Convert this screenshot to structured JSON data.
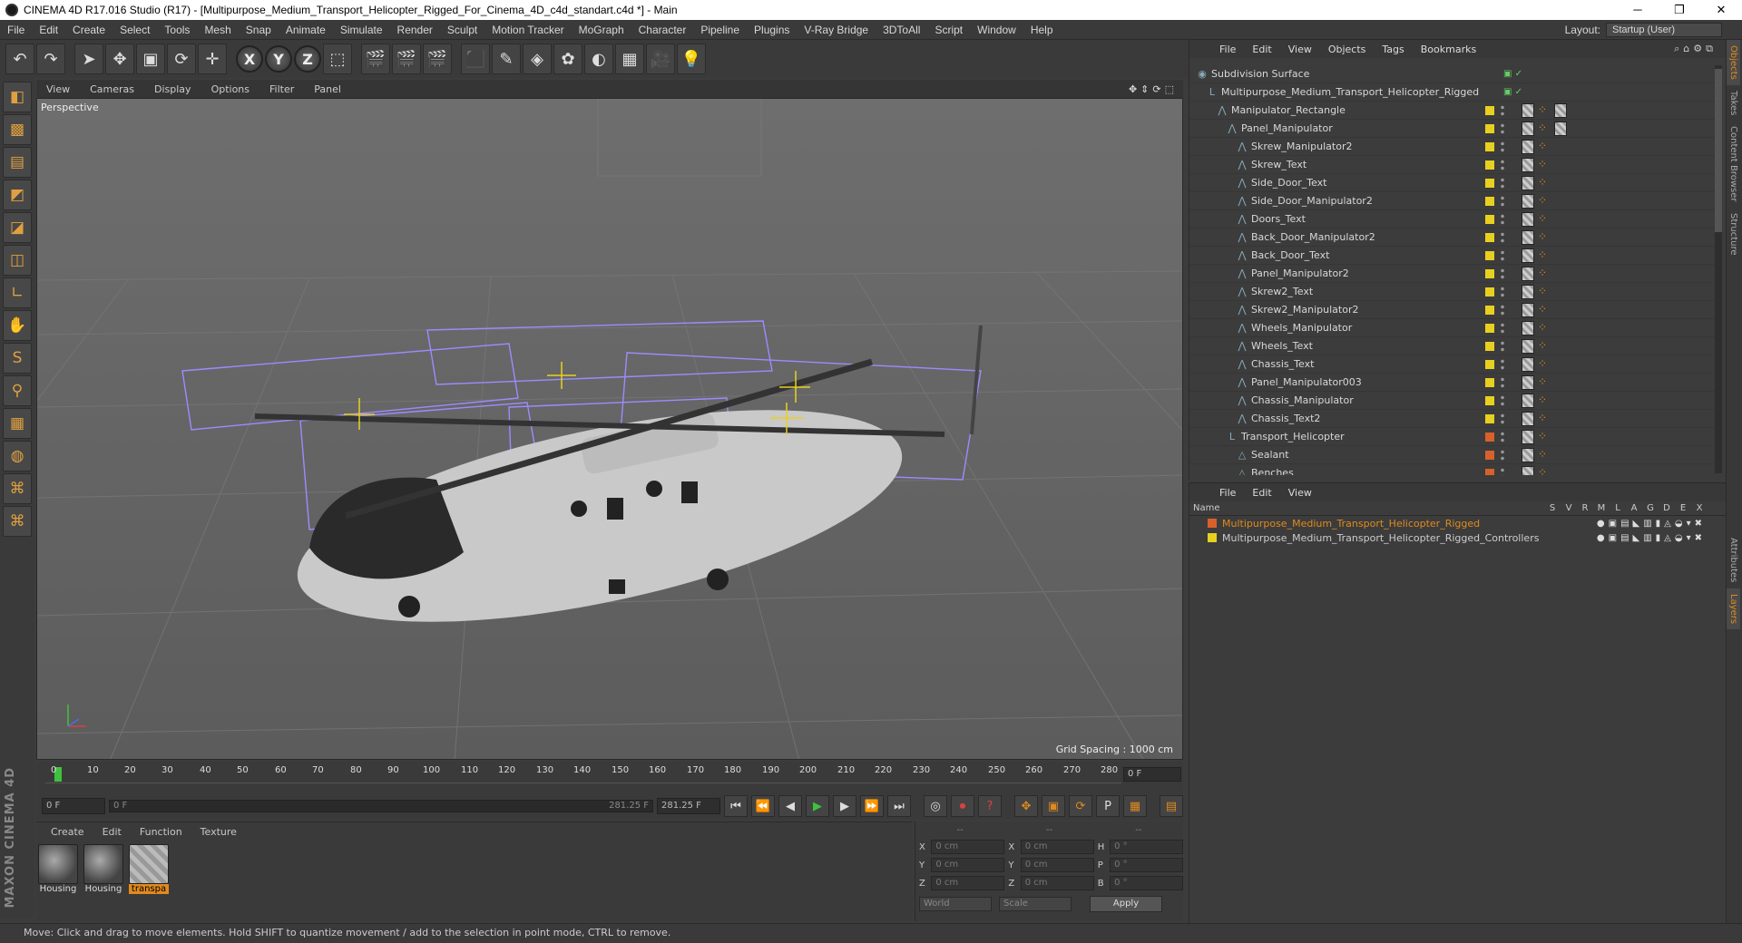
{
  "window": {
    "title": "CINEMA 4D R17.016 Studio (R17) - [Multipurpose_Medium_Transport_Helicopter_Rigged_For_Cinema_4D_c4d_standart.c4d *] - Main",
    "min": "─",
    "max": "❐",
    "close": "✕"
  },
  "menu": [
    "File",
    "Edit",
    "Create",
    "Select",
    "Tools",
    "Mesh",
    "Snap",
    "Animate",
    "Simulate",
    "Render",
    "Sculpt",
    "Motion Tracker",
    "MoGraph",
    "Character",
    "Pipeline",
    "Plugins",
    "V-Ray Bridge",
    "3DToAll",
    "Script",
    "Window",
    "Help"
  ],
  "layout": {
    "label": "Layout:",
    "value": "Startup (User)"
  },
  "toolbar": {
    "undo": "↶",
    "redo": "↷",
    "select": "➤",
    "move": "✥",
    "scale": "▣",
    "rotate": "⟳",
    "move2": "✛",
    "x": "X",
    "y": "Y",
    "z": "Z",
    "coord": "⬚",
    "render_view": "🎬",
    "render": "🎬",
    "render_settings": "🎬",
    "cube": "⬛",
    "pen": "✎",
    "subdiv": "◈",
    "cloner": "✿",
    "deformer": "◐",
    "floor": "▦",
    "camera": "🎥",
    "light": "💡"
  },
  "left_tools": [
    "◧",
    "▩",
    "▤",
    "◩",
    "◪",
    "◫",
    "∟",
    "✋",
    "S",
    "⚲",
    "▦",
    "◍",
    "⌘",
    "⌘"
  ],
  "maxon_logo": "MAXON CINEMA 4D",
  "viewport": {
    "menu": [
      "View",
      "Cameras",
      "Display",
      "Options",
      "Filter",
      "Panel"
    ],
    "nav_icons": "✥⇕⟳⬚",
    "camera": "Perspective",
    "grid_spacing": "Grid Spacing : 1000 cm"
  },
  "timeline": {
    "ticks": [
      "0",
      "10",
      "20",
      "30",
      "40",
      "50",
      "60",
      "70",
      "80",
      "90",
      "100",
      "110",
      "120",
      "130",
      "140",
      "150",
      "160",
      "170",
      "180",
      "190",
      "200",
      "210",
      "220",
      "230",
      "240",
      "250",
      "260",
      "270",
      "280"
    ],
    "current_frame": "0 F",
    "start": "0 F",
    "slider_start": "0 F",
    "slider_end": "281.25 F",
    "end": "281.25 F"
  },
  "transport_buttons": [
    "⏮",
    "⏪",
    "◀",
    "▶",
    "▶",
    "⏩",
    "⏭"
  ],
  "transport_extra": [
    "◎",
    "⏺",
    "?",
    "✥",
    "▣",
    "⟳",
    "P",
    "▦",
    "▤"
  ],
  "materials": {
    "menu": [
      "Create",
      "Edit",
      "Function",
      "Texture"
    ],
    "items": [
      {
        "name": "Housing",
        "style": "ball"
      },
      {
        "name": "Housing",
        "style": "ball"
      },
      {
        "name": "transpa",
        "style": "stripe"
      }
    ]
  },
  "coords": {
    "headers": [
      "--",
      "--",
      "--"
    ],
    "rows": [
      {
        "a1": "X",
        "v1": "0 cm",
        "a2": "X",
        "v2": "0 cm",
        "a3": "H",
        "v3": "0 °"
      },
      {
        "a1": "Y",
        "v1": "0 cm",
        "a2": "Y",
        "v2": "0 cm",
        "a3": "P",
        "v3": "0 °"
      },
      {
        "a1": "Z",
        "v1": "0 cm",
        "a2": "Z",
        "v2": "0 cm",
        "a3": "B",
        "v3": "0 °"
      }
    ],
    "space": "World",
    "mode": "Scale",
    "apply": "Apply"
  },
  "status": "Move: Click and drag to move elements. Hold SHIFT to quantize movement / add to the selection in point mode, CTRL to remove.",
  "object_manager": {
    "menu": [
      "File",
      "Edit",
      "View",
      "Objects",
      "Tags",
      "Bookmarks"
    ],
    "icons": "⌕⌂⚙⧉",
    "objects": [
      {
        "name": "Subdivision Surface",
        "indent": 0,
        "color": "",
        "kind": "subdiv"
      },
      {
        "name": "Multipurpose_Medium_Transport_Helicopter_Rigged",
        "indent": 1,
        "color": "",
        "kind": "null"
      },
      {
        "name": "Manipulator_Rectangle",
        "indent": 2,
        "color": "#e8d020",
        "kind": "spline"
      },
      {
        "name": "Panel_Manipulator",
        "indent": 3,
        "color": "#e8d020",
        "kind": "spline"
      },
      {
        "name": "Skrew_Manipulator2",
        "indent": 4,
        "color": "#e8d020",
        "kind": "spline"
      },
      {
        "name": "Skrew_Text",
        "indent": 4,
        "color": "#e8d020",
        "kind": "spline"
      },
      {
        "name": "Side_Door_Text",
        "indent": 4,
        "color": "#e8d020",
        "kind": "spline"
      },
      {
        "name": "Side_Door_Manipulator2",
        "indent": 4,
        "color": "#e8d020",
        "kind": "spline"
      },
      {
        "name": "Doors_Text",
        "indent": 4,
        "color": "#e8d020",
        "kind": "spline"
      },
      {
        "name": "Back_Door_Manipulator2",
        "indent": 4,
        "color": "#e8d020",
        "kind": "spline"
      },
      {
        "name": "Back_Door_Text",
        "indent": 4,
        "color": "#e8d020",
        "kind": "spline"
      },
      {
        "name": "Panel_Manipulator2",
        "indent": 4,
        "color": "#e8d020",
        "kind": "spline"
      },
      {
        "name": "Skrew2_Text",
        "indent": 4,
        "color": "#e8d020",
        "kind": "spline"
      },
      {
        "name": "Skrew2_Manipulator2",
        "indent": 4,
        "color": "#e8d020",
        "kind": "spline"
      },
      {
        "name": "Wheels_Manipulator",
        "indent": 4,
        "color": "#e8d020",
        "kind": "spline"
      },
      {
        "name": "Wheels_Text",
        "indent": 4,
        "color": "#e8d020",
        "kind": "spline"
      },
      {
        "name": "Chassis_Text",
        "indent": 4,
        "color": "#e8d020",
        "kind": "spline"
      },
      {
        "name": "Panel_Manipulator003",
        "indent": 4,
        "color": "#e8d020",
        "kind": "spline"
      },
      {
        "name": "Chassis_Manipulator",
        "indent": 4,
        "color": "#e8d020",
        "kind": "spline"
      },
      {
        "name": "Chassis_Text2",
        "indent": 4,
        "color": "#e8d020",
        "kind": "spline"
      },
      {
        "name": "Transport_Helicopter",
        "indent": 3,
        "color": "#d8602a",
        "kind": "null"
      },
      {
        "name": "Sealant",
        "indent": 4,
        "color": "#d8602a",
        "kind": "poly"
      },
      {
        "name": "Benches",
        "indent": 4,
        "color": "#d8602a",
        "kind": "poly"
      }
    ]
  },
  "side_tabs": [
    "Objects",
    "Takes",
    "Content Browser",
    "Structure",
    "Attributes",
    "Layers"
  ],
  "layer_manager": {
    "menu": [
      "File",
      "Edit",
      "View"
    ],
    "name_header": "Name",
    "columns": [
      "S",
      "V",
      "R",
      "M",
      "L",
      "A",
      "G",
      "D",
      "E",
      "X"
    ],
    "layers": [
      {
        "name": "Multipurpose_Medium_Transport_Helicopter_Rigged",
        "color": "#d8602a"
      },
      {
        "name": "Multipurpose_Medium_Transport_Helicopter_Rigged_Controllers",
        "color": "#e8d020"
      }
    ],
    "layer_icons": "●▣▤◣▥▮◬◒▾✖"
  },
  "colors": {
    "accent": "#e08a1e",
    "play": "#3ec23e",
    "selection_box": "#9b8cff"
  }
}
